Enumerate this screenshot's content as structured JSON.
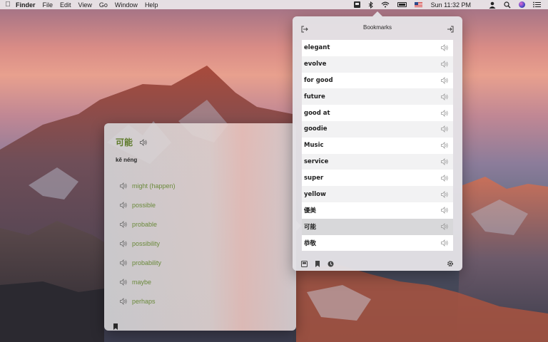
{
  "menubar": {
    "apple_icon": "apple-icon",
    "app_name": "Finder",
    "menus": [
      "File",
      "Edit",
      "View",
      "Go",
      "Window",
      "Help"
    ],
    "status_icons": [
      "bookmark-app-icon",
      "bluetooth-icon",
      "wifi-icon",
      "battery-icon",
      "us-flag-icon"
    ],
    "clock": "Sun 11:32 PM",
    "right_icons": [
      "user-icon",
      "search-icon",
      "siri-icon",
      "list-icon"
    ]
  },
  "definition": {
    "word": "可能",
    "pinyin": "kě néng",
    "meanings": [
      "might (happen)",
      "possible",
      "probable",
      "possibility",
      "probability",
      "maybe",
      "perhaps"
    ],
    "colors": {
      "word": "#5e7a2a",
      "meaning": "#6b8a3c"
    }
  },
  "bookmarks": {
    "title": "Bookmarks",
    "items": [
      "elegant",
      "evolve",
      "for good",
      "future",
      "good at",
      "goodie",
      "Music",
      "service",
      "super",
      "yellow",
      "優美",
      "可能",
      "恭敬"
    ],
    "selected_index": 11
  }
}
